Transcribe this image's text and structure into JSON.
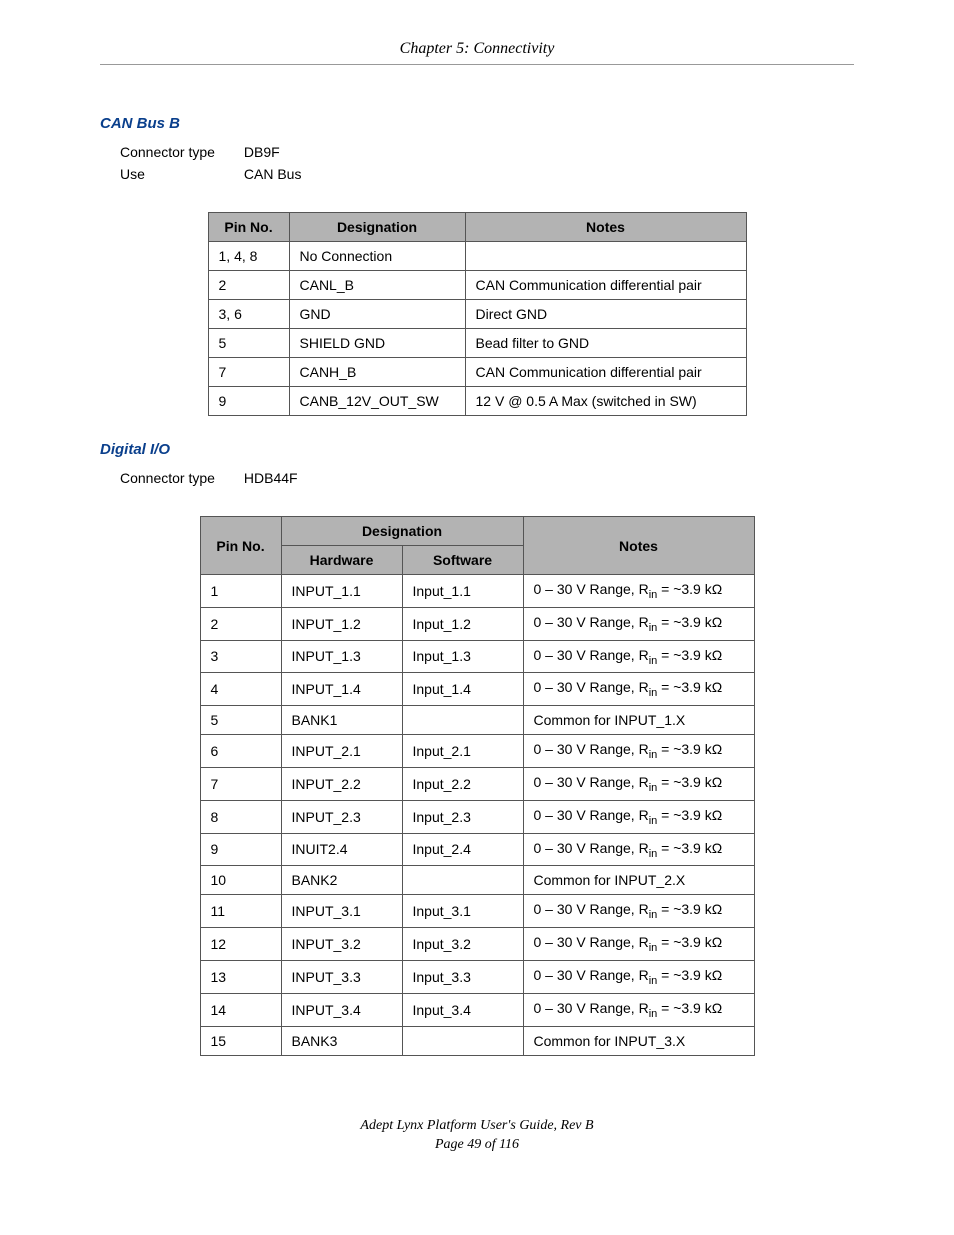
{
  "header": {
    "chapter": "Chapter 5: Connectivity"
  },
  "section1": {
    "title": "CAN Bus B",
    "connector_type_label": "Connector type",
    "connector_type_value": "DB9F",
    "use_label": "Use",
    "use_value": "CAN Bus",
    "table": {
      "head": {
        "c1": "Pin No.",
        "c2": "Designation",
        "c3": "Notes"
      },
      "rows": [
        {
          "c1": "1, 4, 8",
          "c2": "No Connection",
          "c3": ""
        },
        {
          "c1": "2",
          "c2": "CANL_B",
          "c3": "CAN Communication differential pair"
        },
        {
          "c1": "3, 6",
          "c2": "GND",
          "c3": "Direct GND"
        },
        {
          "c1": "5",
          "c2": "SHIELD GND",
          "c3": "Bead filter to GND"
        },
        {
          "c1": "7",
          "c2": "CANH_B",
          "c3": "CAN Communication differential pair"
        },
        {
          "c1": "9",
          "c2": "CANB_12V_OUT_SW",
          "c3": "12 V @ 0.5 A Max (switched in SW)"
        }
      ]
    }
  },
  "section2": {
    "title": "Digital I/O",
    "connector_type_label": "Connector type",
    "connector_type_value": "HDB44F",
    "table": {
      "head": {
        "designation": "Designation",
        "c1": "Pin No.",
        "c2": "Hardware",
        "c3": "Software",
        "c4": "Notes"
      },
      "rows": [
        {
          "c1": "1",
          "c2": "INPUT_1.1",
          "c3": "Input_1.1",
          "c4_type": "range"
        },
        {
          "c1": "2",
          "c2": "INPUT_1.2",
          "c3": "Input_1.2",
          "c4_type": "range"
        },
        {
          "c1": "3",
          "c2": "INPUT_1.3",
          "c3": "Input_1.3",
          "c4_type": "range"
        },
        {
          "c1": "4",
          "c2": "INPUT_1.4",
          "c3": "Input_1.4",
          "c4_type": "range"
        },
        {
          "c1": "5",
          "c2": "BANK1",
          "c3": "",
          "c4_type": "common",
          "c4": "Common for INPUT_1.X"
        },
        {
          "c1": "6",
          "c2": "INPUT_2.1",
          "c3": "Input_2.1",
          "c4_type": "range"
        },
        {
          "c1": "7",
          "c2": "INPUT_2.2",
          "c3": "Input_2.2",
          "c4_type": "range"
        },
        {
          "c1": "8",
          "c2": "INPUT_2.3",
          "c3": "Input_2.3",
          "c4_type": "range"
        },
        {
          "c1": "9",
          "c2": "INUIT2.4",
          "c3": "Input_2.4",
          "c4_type": "range"
        },
        {
          "c1": "10",
          "c2": "BANK2",
          "c3": "",
          "c4_type": "common",
          "c4": "Common for INPUT_2.X"
        },
        {
          "c1": "11",
          "c2": "INPUT_3.1",
          "c3": "Input_3.1",
          "c4_type": "range"
        },
        {
          "c1": "12",
          "c2": "INPUT_3.2",
          "c3": "Input_3.2",
          "c4_type": "range"
        },
        {
          "c1": "13",
          "c2": "INPUT_3.3",
          "c3": "Input_3.3",
          "c4_type": "range"
        },
        {
          "c1": "14",
          "c2": "INPUT_3.4",
          "c3": "Input_3.4",
          "c4_type": "range"
        },
        {
          "c1": "15",
          "c2": "BANK3",
          "c3": "",
          "c4_type": "common",
          "c4": "Common for INPUT_3.X"
        }
      ],
      "range_note": {
        "prefix": "0 – 30 V Range, R",
        "sub": "in",
        "suffix": " = ~3.9 kΩ"
      }
    }
  },
  "footer": {
    "line1": "Adept Lynx Platform User's Guide, Rev B",
    "line2": "Page 49 of 116"
  }
}
